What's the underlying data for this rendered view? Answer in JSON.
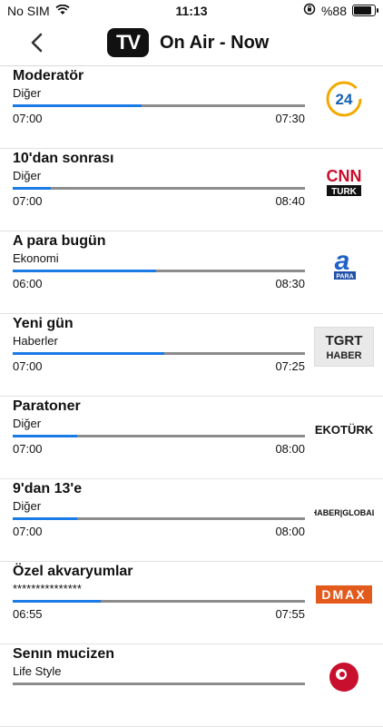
{
  "status": {
    "carrier": "No SIM",
    "time": "11:13",
    "battery": "%88"
  },
  "nav": {
    "title": "On Air - Now",
    "logo_text": "TV"
  },
  "programs": [
    {
      "title": "Moderatör",
      "genre": "Diğer",
      "start": "07:00",
      "end": "07:30",
      "progress": 0.44,
      "channel_logo": "24-logo"
    },
    {
      "title": "10'dan sonrası",
      "genre": "Diğer",
      "start": "07:00",
      "end": "08:40",
      "progress": 0.13,
      "channel_logo": "cnn-turk-logo"
    },
    {
      "title": "A para bugün",
      "genre": "Ekonomi",
      "start": "06:00",
      "end": "08:30",
      "progress": 0.49,
      "channel_logo": "a-para-logo"
    },
    {
      "title": "Yeni gün",
      "genre": "Haberler",
      "start": "07:00",
      "end": "07:25",
      "progress": 0.52,
      "channel_logo": "tgrt-haber-logo"
    },
    {
      "title": "Paratoner",
      "genre": "Diğer",
      "start": "07:00",
      "end": "08:00",
      "progress": 0.22,
      "channel_logo": "ekoturk-logo"
    },
    {
      "title": "9'dan 13'e",
      "genre": "Diğer",
      "start": "07:00",
      "end": "08:00",
      "progress": 0.22,
      "channel_logo": "haber-global-logo"
    },
    {
      "title": "Özel akvaryumlar",
      "genre": "***************",
      "start": "06:55",
      "end": "07:55",
      "progress": 0.3,
      "channel_logo": "dmax-logo"
    },
    {
      "title": "Senın mucizen",
      "genre": "Life Style",
      "start": "",
      "end": "",
      "progress": 0.0,
      "channel_logo": "red-circle-logo"
    }
  ],
  "logo_text": {
    "cnn": "CNN",
    "turk": "TURK",
    "apara_a": "a",
    "apara": "PARA",
    "tgrt": "TGRT",
    "haber": "HABER",
    "ekoturk": "EKOTÜRK",
    "haberglobal": "HABER|GLOBAL",
    "dmax": "DMAX",
    "num24": "24"
  },
  "colors": {
    "progress": "#1a7ae6",
    "track": "#8c8c8c"
  }
}
